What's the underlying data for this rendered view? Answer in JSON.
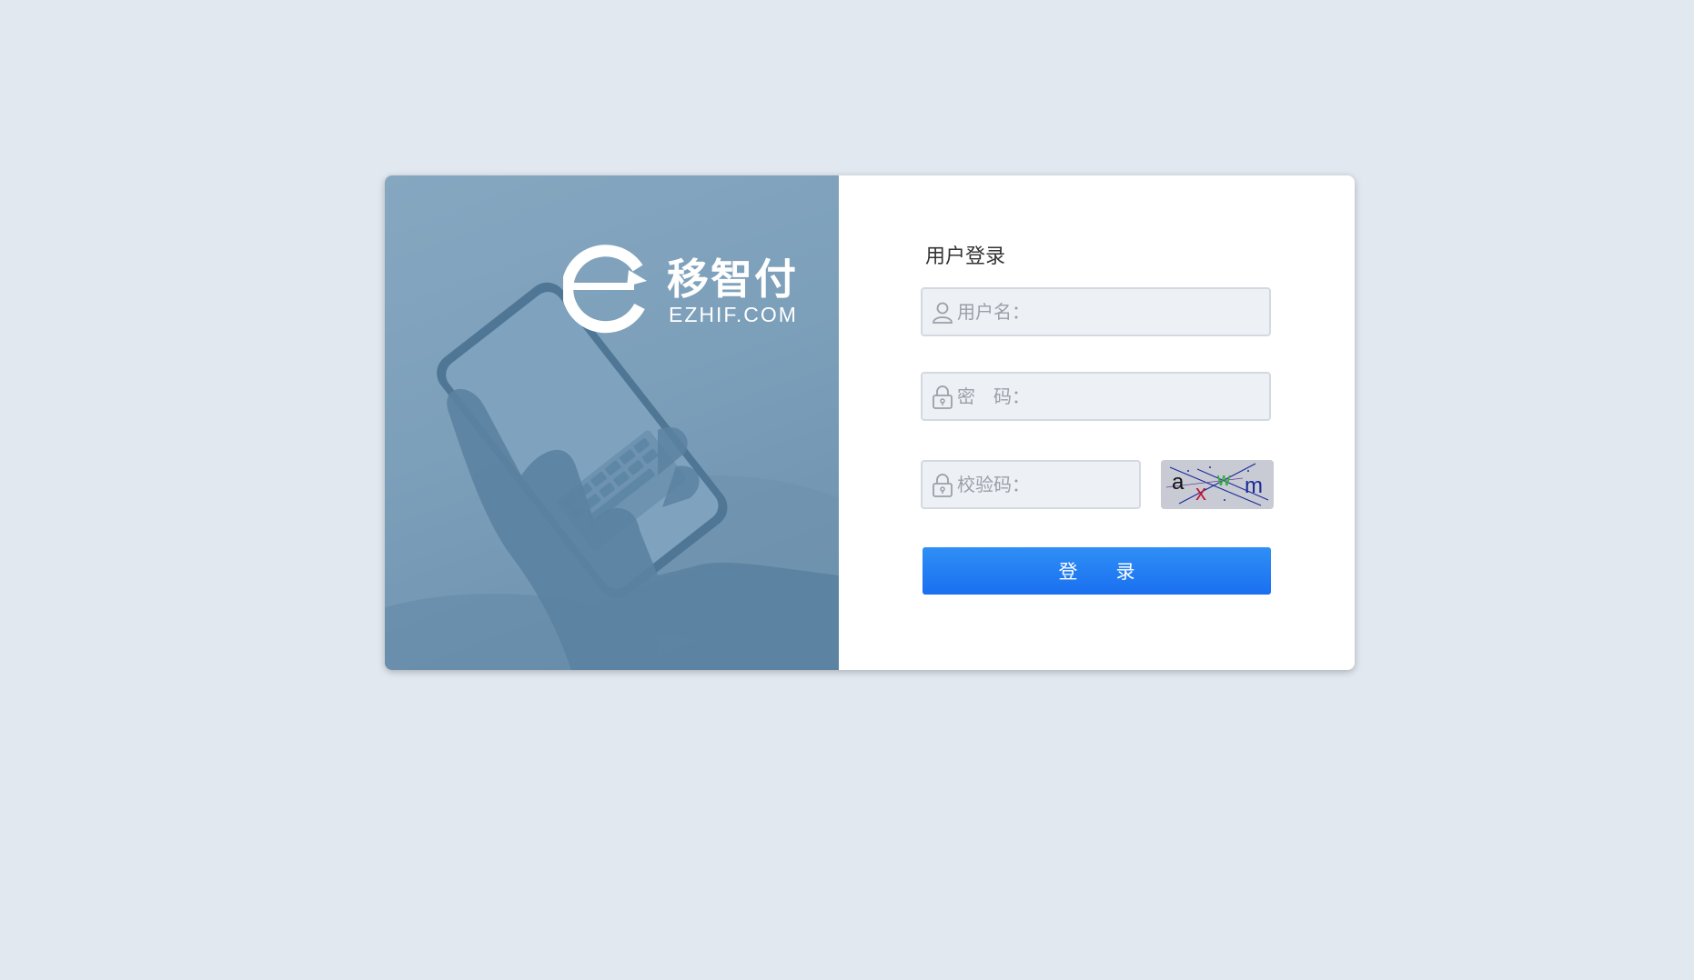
{
  "brand": {
    "name_cn": "移智付",
    "name_en": "EZHIF.COM"
  },
  "login": {
    "title": "用户登录",
    "username_placeholder": "用户名：",
    "password_placeholder": "密　码：",
    "captcha_placeholder": "校验码：",
    "captcha_text": "axwm",
    "submit_label": "登　　录"
  },
  "colors": {
    "page_bg": "#e1e8ef",
    "hero_bg": "#7c9fba",
    "button_blue": "#1a6ff0",
    "field_bg": "#edf0f5"
  },
  "icons": {
    "username": "user-icon",
    "password": "lock-icon",
    "captcha": "lock-icon"
  }
}
